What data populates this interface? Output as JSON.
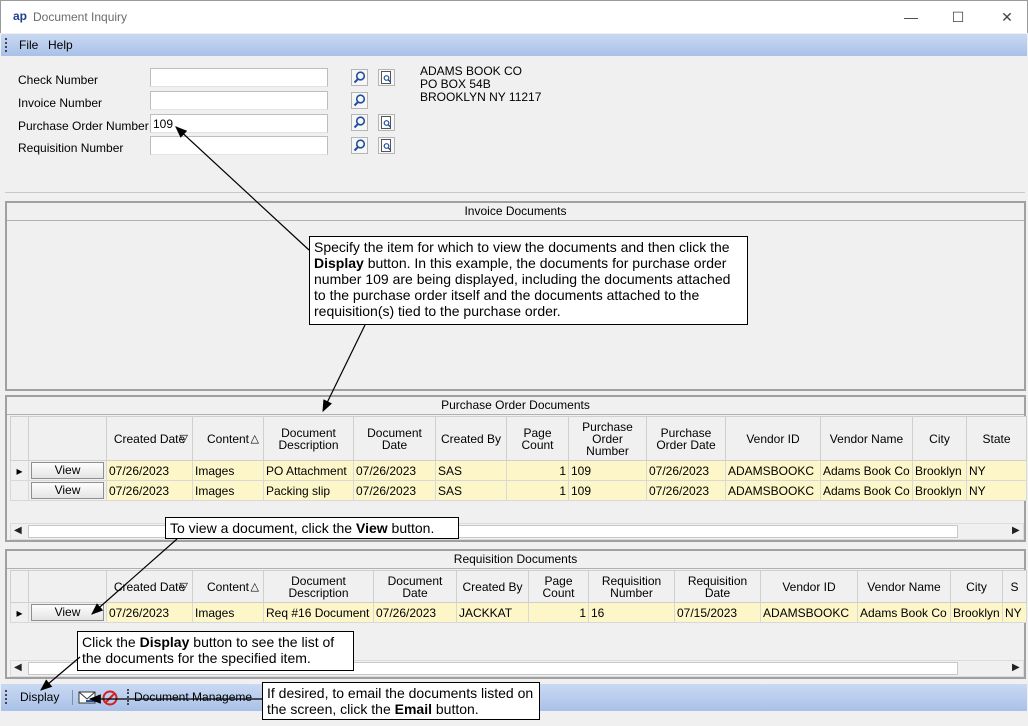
{
  "window": {
    "logo": "ap",
    "title": "Document Inquiry",
    "minimize": "—",
    "maximize": "☐",
    "close": "✕"
  },
  "menu": {
    "items": [
      "File",
      "Help"
    ]
  },
  "form": {
    "check_number": {
      "label": "Check Number",
      "value": ""
    },
    "invoice_number": {
      "label": "Invoice Number",
      "value": ""
    },
    "po_number": {
      "label": "Purchase Order Number",
      "value": "109"
    },
    "requisition_number": {
      "label": "Requisition Number",
      "value": ""
    },
    "vendor_address": [
      "ADAMS BOOK CO",
      "PO BOX 54B",
      "BROOKLYN NY  11217"
    ]
  },
  "invoice_panel": {
    "title": "Invoice Documents"
  },
  "po_panel": {
    "title": "Purchase Order Documents",
    "columns": [
      "Created Date",
      "Content",
      "Document Description",
      "Document Date",
      "Created By",
      "Page Count",
      "Purchase Order Number",
      "Purchase Order Date",
      "Vendor ID",
      "Vendor Name",
      "City",
      "State"
    ],
    "rows": [
      {
        "button": "View",
        "cells": [
          "07/26/2023",
          "Images",
          "PO Attachment",
          "07/26/2023",
          "SAS",
          "1",
          "109",
          "07/26/2023",
          "ADAMSBOOKC",
          "Adams Book Co",
          "Brooklyn",
          "NY"
        ]
      },
      {
        "button": "View",
        "cells": [
          "07/26/2023",
          "Images",
          "Packing slip",
          "07/26/2023",
          "SAS",
          "1",
          "109",
          "07/26/2023",
          "ADAMSBOOKC",
          "Adams Book Co",
          "Brooklyn",
          "NY"
        ]
      }
    ]
  },
  "req_panel": {
    "title": "Requisition Documents",
    "columns": [
      "Created Date",
      "Content",
      "Document Description",
      "Document Date",
      "Created By",
      "Page Count",
      "Requisition Number",
      "Requisition Date",
      "Vendor ID",
      "Vendor Name",
      "City",
      "S"
    ],
    "rows": [
      {
        "button": "View",
        "cells": [
          "07/26/2023",
          "Images",
          "Req #16 Document",
          "07/26/2023",
          "JACKKAT",
          "1",
          "16",
          "07/15/2023",
          "ADAMSBOOKC",
          "Adams Book Co",
          "Brooklyn",
          "NY"
        ]
      }
    ]
  },
  "toolbar": {
    "display": "Display",
    "doc_mgmt_tab": "Document Manageme"
  },
  "callouts": {
    "specify": {
      "pre": "Specify the item for which to view the documents and then click the ",
      "bold": "Display",
      "post": " button.  In this example, the documents for purchase order number 109 are being displayed, including the documents attached to the purchase order itself and the documents attached to the requisition(s) tied to the purchase order."
    },
    "view": {
      "pre": "To view a document, click the ",
      "bold": "View",
      "post": " button."
    },
    "display": {
      "pre": "Click the ",
      "bold": "Display",
      "post": " button to see the list of the documents for the specified item."
    },
    "email": {
      "pre": "If desired, to email the documents listed on the screen, click the ",
      "bold": "Email",
      "post": " button."
    }
  },
  "colors": {
    "menubar": "#b9cdee",
    "row_highlight": "#fdf6c9"
  }
}
